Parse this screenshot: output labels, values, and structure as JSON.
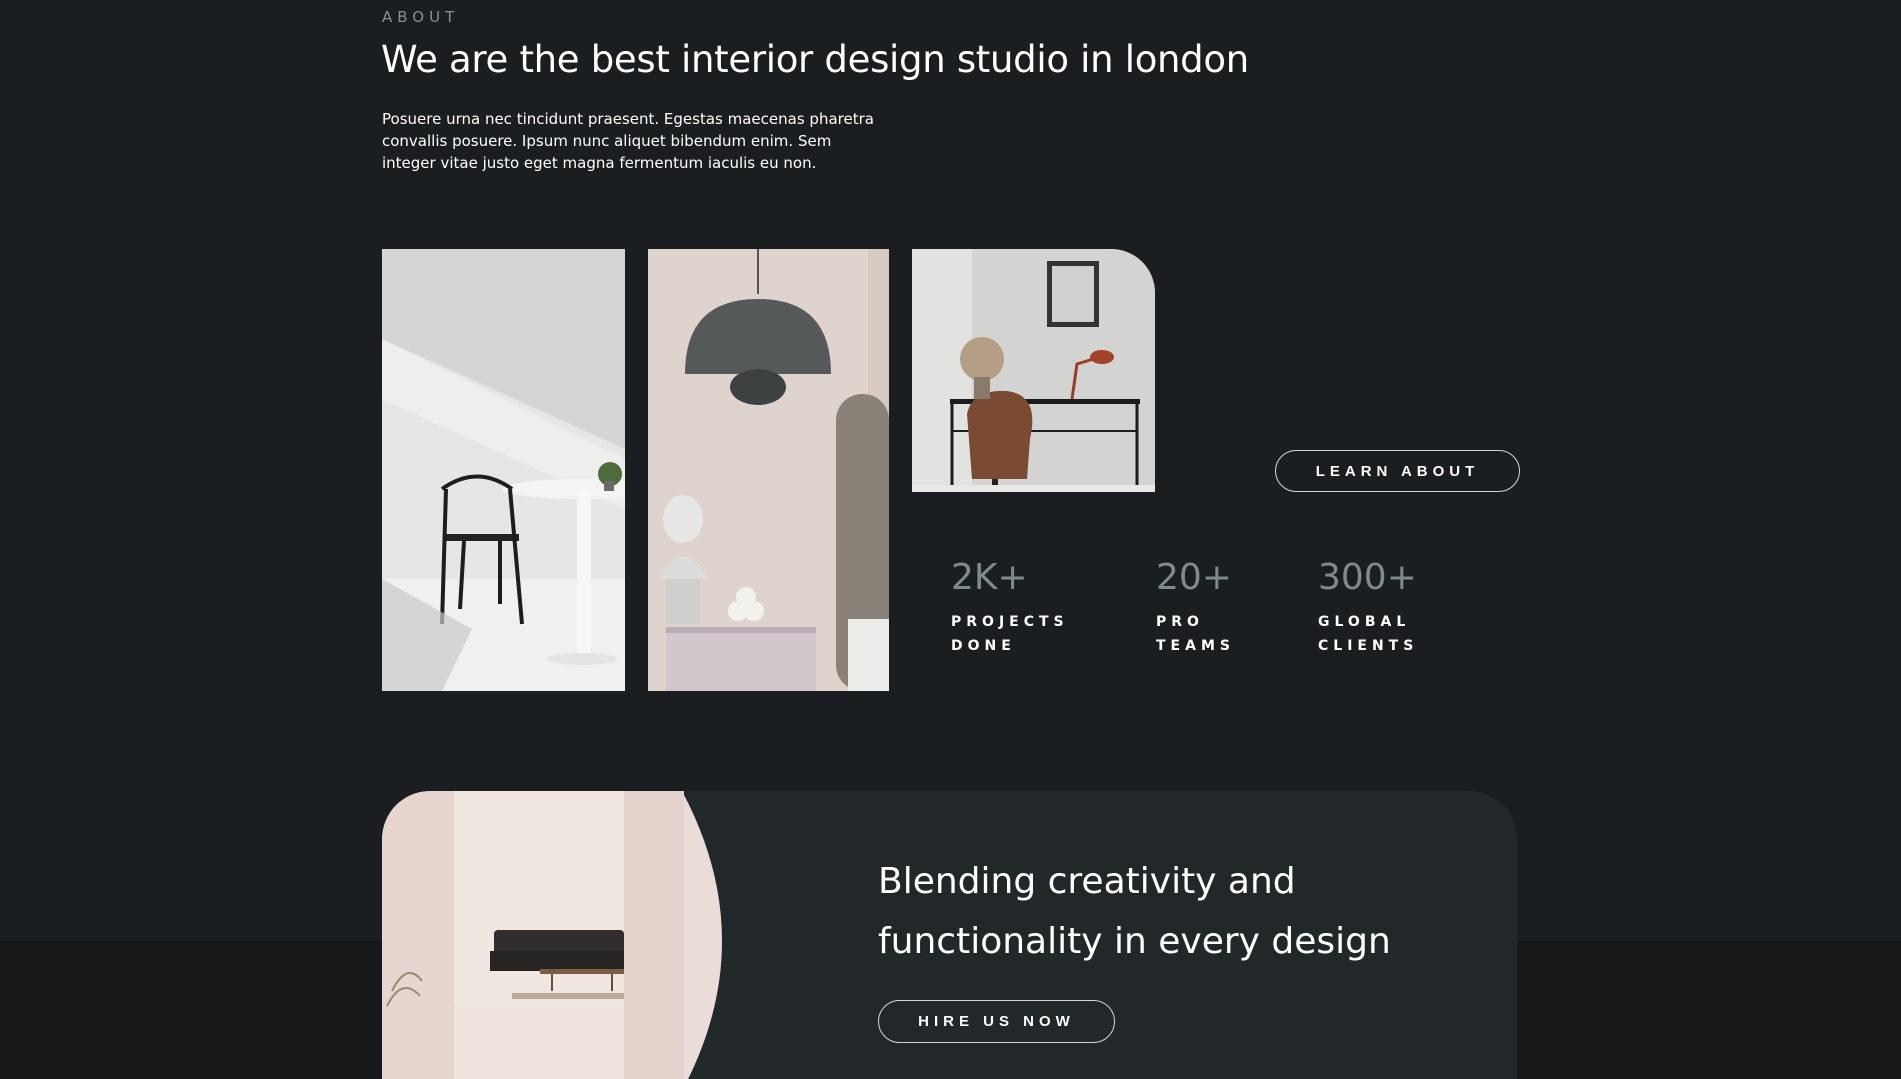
{
  "about": {
    "eyebrow": "ABOUT",
    "headline": "We are the best interior design studio in london",
    "intro": "Posuere urna nec tincidunt praesent. Egestas maecenas pharetra convallis posuere. Ipsum nunc aliquet bibendum enim. Sem integer vitae justo eget magna fermentum iaculis eu non.",
    "learn_button": "LEARN ABOUT"
  },
  "stats": [
    {
      "number": "2K+",
      "label": "PROJECTS\nDONE"
    },
    {
      "number": "20+",
      "label": "PRO\nTEAMS"
    },
    {
      "number": "300+",
      "label": "GLOBAL\nCLIENTS"
    }
  ],
  "cta": {
    "title": "Blending creativity and functionality in every design",
    "button": "HIRE US NOW"
  },
  "colors": {
    "background": "#1b1e20",
    "card": "#222729",
    "stat_number": "#7e8b8c",
    "muted_text": "#8a8f90"
  }
}
